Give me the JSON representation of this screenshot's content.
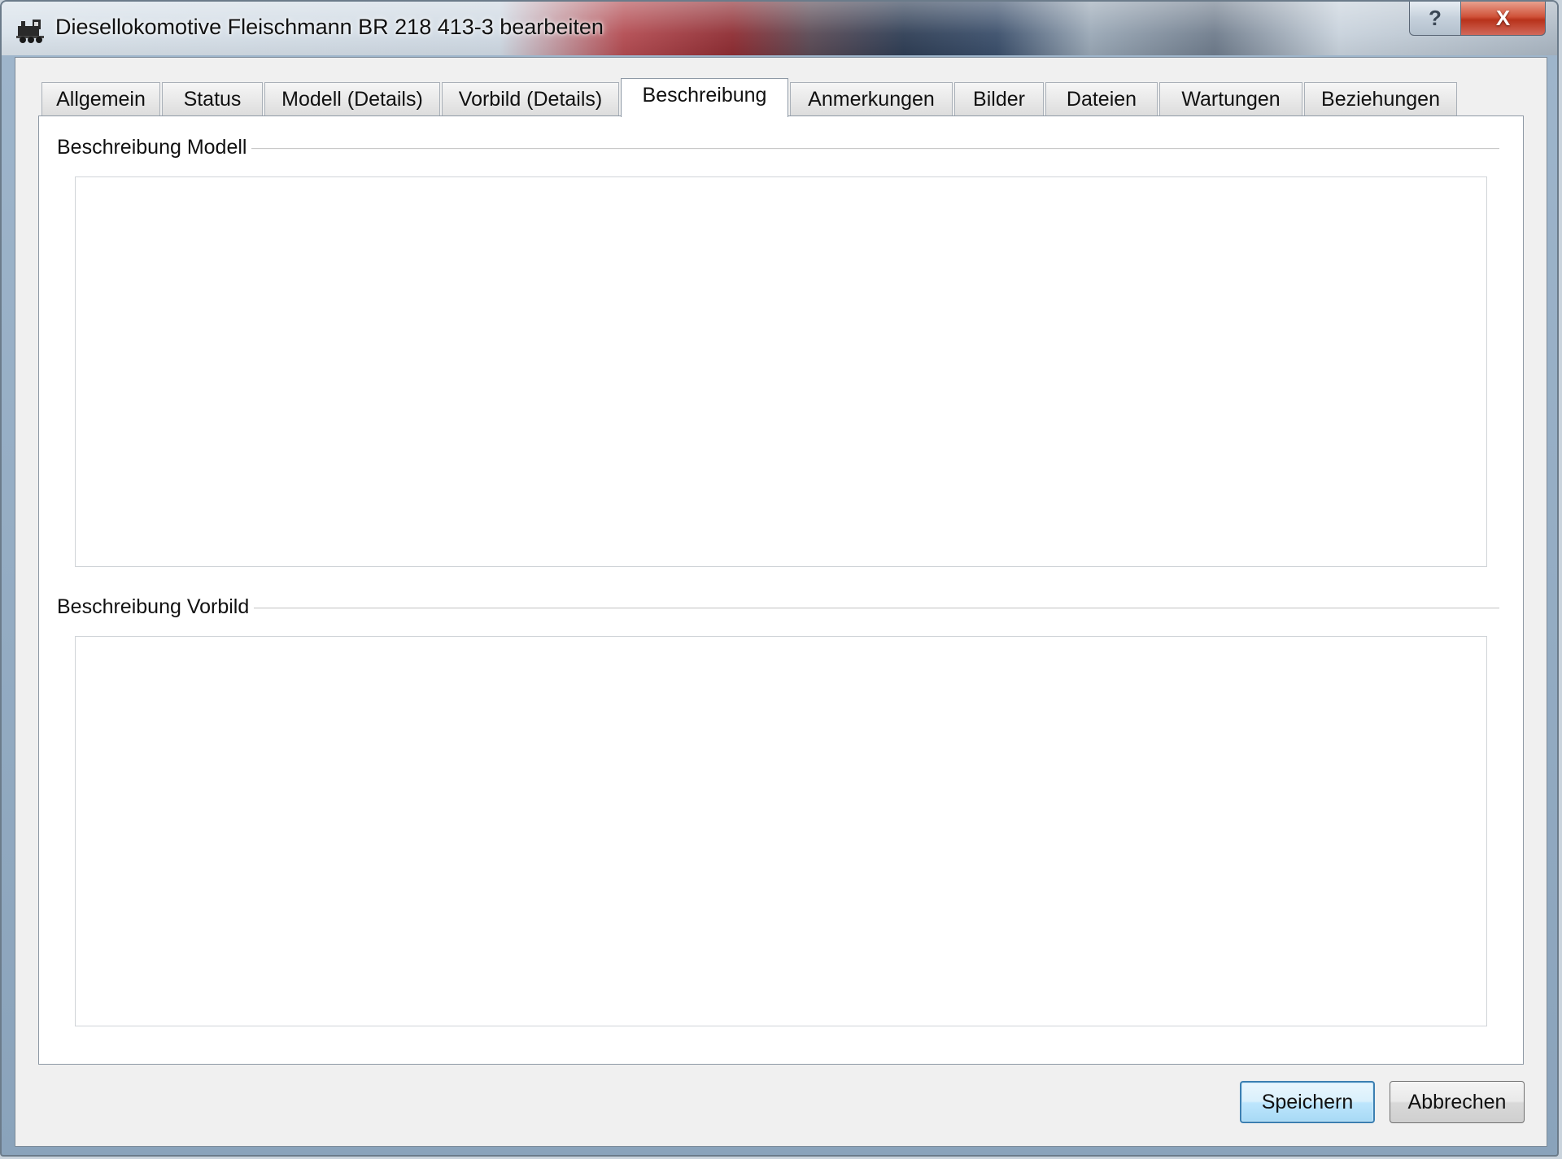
{
  "window": {
    "title": "Diesellokomotive Fleischmann BR 218 413-3 bearbeiten",
    "app_icon": "locomotive-icon",
    "help_label": "?",
    "close_label": "X"
  },
  "tabs": [
    {
      "label": "Allgemein",
      "active": false
    },
    {
      "label": "Status",
      "active": false
    },
    {
      "label": "Modell (Details)",
      "active": false
    },
    {
      "label": "Vorbild (Details)",
      "active": false
    },
    {
      "label": "Beschreibung",
      "active": true
    },
    {
      "label": "Anmerkungen",
      "active": false
    },
    {
      "label": "Bilder",
      "active": false
    },
    {
      "label": "Dateien",
      "active": false
    },
    {
      "label": "Wartungen",
      "active": false
    },
    {
      "label": "Beziehungen",
      "active": false
    }
  ],
  "groups": {
    "model": {
      "title": "Beschreibung Modell",
      "value": ""
    },
    "prototype": {
      "title": "Beschreibung Vorbild",
      "value": ""
    }
  },
  "buttons": {
    "save_label": "Speichern",
    "cancel_label": "Abbrechen"
  },
  "colors": {
    "accent_button_border": "#3c7fb1",
    "close_button": "#c8442a"
  }
}
